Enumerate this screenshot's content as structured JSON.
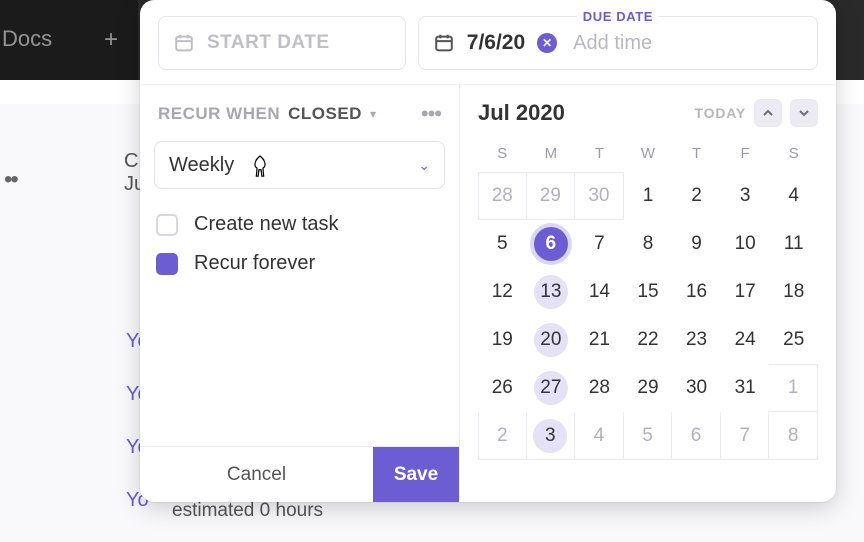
{
  "background": {
    "docs_label": "Docs",
    "plus_label": "+",
    "meta_line": "Ju",
    "list_items": [
      "Yo",
      "Yo",
      "Yo",
      "Yo"
    ],
    "estimate_text": "estimated 0 hours"
  },
  "modal": {
    "start": {
      "placeholder": "START DATE"
    },
    "due": {
      "label": "DUE DATE",
      "value": "7/6/20",
      "add_time": "Add time"
    },
    "recur": {
      "label_a": "RECUR WHEN",
      "label_b": "CLOSED",
      "frequency": "Weekly",
      "opt_create": "Create new task",
      "opt_forever": "Recur forever",
      "opt_create_checked": false,
      "opt_forever_checked": true
    },
    "buttons": {
      "cancel": "Cancel",
      "save": "Save"
    },
    "calendar": {
      "month_label": "Jul 2020",
      "today_label": "TODAY",
      "dow": [
        "S",
        "M",
        "T",
        "W",
        "T",
        "F",
        "S"
      ],
      "weeks": [
        [
          {
            "n": 28,
            "muted": true,
            "boxed": true,
            "boxed_l": true,
            "boxed_t": true
          },
          {
            "n": 29,
            "muted": true,
            "boxed": true,
            "boxed_t": true
          },
          {
            "n": 30,
            "muted": true,
            "boxed": true,
            "boxed_t": true
          },
          {
            "n": 1
          },
          {
            "n": 2
          },
          {
            "n": 3
          },
          {
            "n": 4
          }
        ],
        [
          {
            "n": 5
          },
          {
            "n": 6,
            "sel": true
          },
          {
            "n": 7
          },
          {
            "n": 8
          },
          {
            "n": 9
          },
          {
            "n": 10
          },
          {
            "n": 11
          }
        ],
        [
          {
            "n": 12
          },
          {
            "n": 13,
            "hl": true
          },
          {
            "n": 14
          },
          {
            "n": 15
          },
          {
            "n": 16
          },
          {
            "n": 17
          },
          {
            "n": 18
          }
        ],
        [
          {
            "n": 19
          },
          {
            "n": 20,
            "hl": true
          },
          {
            "n": 21
          },
          {
            "n": 22
          },
          {
            "n": 23
          },
          {
            "n": 24
          },
          {
            "n": 25
          }
        ],
        [
          {
            "n": 26
          },
          {
            "n": 27,
            "hl": true
          },
          {
            "n": 28
          },
          {
            "n": 29
          },
          {
            "n": 30
          },
          {
            "n": 31
          },
          {
            "n": 1,
            "muted": true,
            "boxed": true,
            "boxed_t": true
          }
        ],
        [
          {
            "n": 2,
            "muted": true,
            "boxed": true,
            "boxed_l": true
          },
          {
            "n": 3,
            "muted": true,
            "hl": true,
            "boxed": true
          },
          {
            "n": 4,
            "muted": true,
            "boxed": true
          },
          {
            "n": 5,
            "muted": true,
            "boxed": true
          },
          {
            "n": 6,
            "muted": true,
            "boxed": true
          },
          {
            "n": 7,
            "muted": true,
            "boxed": true
          },
          {
            "n": 8,
            "muted": true,
            "boxed": true
          }
        ]
      ]
    }
  }
}
